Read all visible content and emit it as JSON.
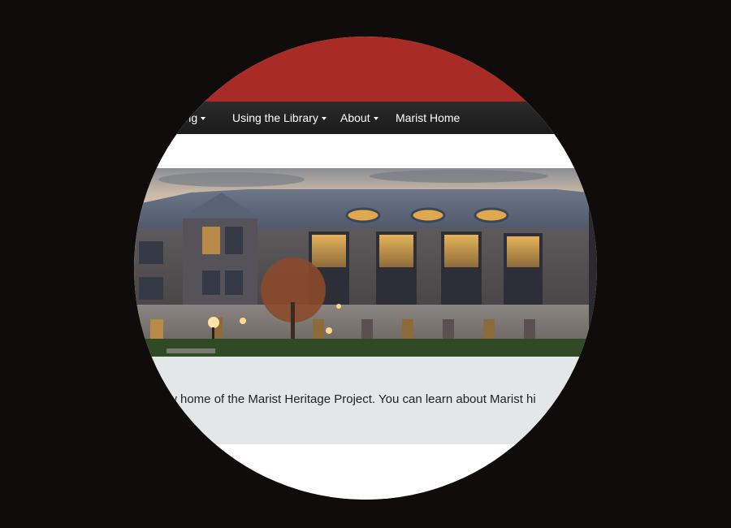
{
  "nav": {
    "items": [
      {
        "label": "rching",
        "has_caret": true
      },
      {
        "label": "Using the Library",
        "has_caret": true
      },
      {
        "label": "About",
        "has_caret": true
      },
      {
        "label": "Marist Home",
        "has_caret": false
      }
    ]
  },
  "hero": {
    "alt": "Library building at dusk"
  },
  "main": {
    "intro_text": "w home of the Marist Heritage Project. You can learn about Marist hi"
  },
  "colors": {
    "header_red": "#a82b25",
    "navbar": "#222222",
    "content_bg": "#e4e7e7"
  }
}
